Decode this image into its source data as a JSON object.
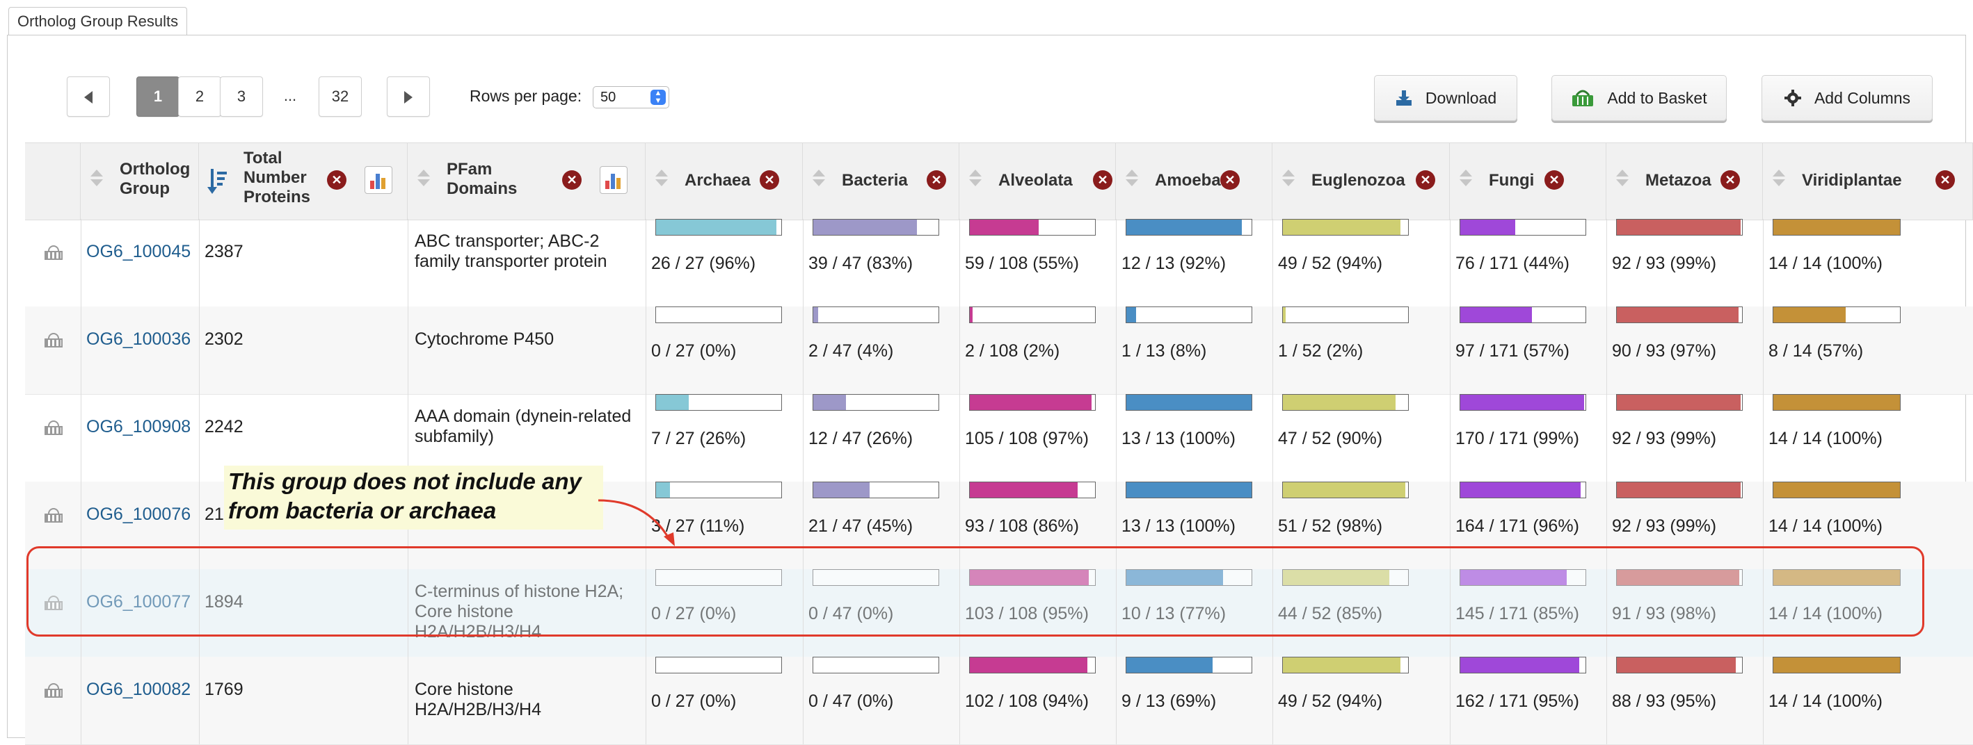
{
  "tab_label": "Ortholog Group Results",
  "pager": {
    "pages": [
      "1",
      "2",
      "3",
      "...",
      "32"
    ],
    "current": "1",
    "rows_per_page_label": "Rows per page:",
    "rows_per_page_value": "50"
  },
  "actions": {
    "download": "Download",
    "add_to_basket": "Add to Basket",
    "add_columns": "Add Columns"
  },
  "columns": {
    "group": "Ortholog Group",
    "total": "Total Number Proteins",
    "pfam": "PFam Domains",
    "taxa": [
      "Archaea",
      "Bacteria",
      "Alveolata",
      "Amoeba",
      "Euglenozoa",
      "Fungi",
      "Metazoa",
      "Viridiplantae"
    ]
  },
  "taxa_colors": [
    "#86c8d6",
    "#9d98c8",
    "#c63b92",
    "#4a8ec4",
    "#cfcf72",
    "#9f48d9",
    "#c96060",
    "#c49138"
  ],
  "rows": [
    {
      "group": "OG6_100045",
      "total": "2387",
      "pfam": "ABC transporter; ABC-2 family transporter protein",
      "counts": [
        "26 / 27 (96%)",
        "39 / 47 (83%)",
        "59 / 108 (55%)",
        "12 / 13 (92%)",
        "49 / 52 (94%)",
        "76 / 171 (44%)",
        "92 / 93 (99%)",
        "14 / 14 (100%)"
      ],
      "pct": [
        0.96,
        0.83,
        0.55,
        0.92,
        0.94,
        0.44,
        0.99,
        1.0
      ]
    },
    {
      "group": "OG6_100036",
      "total": "2302",
      "pfam": "Cytochrome P450",
      "counts": [
        "0 / 27 (0%)",
        "2 / 47 (4%)",
        "2 / 108 (2%)",
        "1 / 13 (8%)",
        "1 / 52 (2%)",
        "97 / 171 (57%)",
        "90 / 93 (97%)",
        "8 / 14 (57%)"
      ],
      "pct": [
        0.0,
        0.04,
        0.02,
        0.08,
        0.02,
        0.57,
        0.97,
        0.57
      ]
    },
    {
      "group": "OG6_100908",
      "total": "2242",
      "pfam": "AAA domain (dynein-related subfamily)",
      "counts": [
        "7 / 27 (26%)",
        "12 / 47 (26%)",
        "105 / 108 (97%)",
        "13 / 13 (100%)",
        "47 / 52 (90%)",
        "170 / 171 (99%)",
        "92 / 93 (99%)",
        "14 / 14 (100%)"
      ],
      "pct": [
        0.26,
        0.26,
        0.97,
        1.0,
        0.9,
        0.99,
        0.99,
        1.0
      ]
    },
    {
      "group": "OG6_100076",
      "total": "21",
      "pfam": "",
      "counts": [
        "3 / 27 (11%)",
        "21 / 47 (45%)",
        "93 / 108 (86%)",
        "13 / 13 (100%)",
        "51 / 52 (98%)",
        "164 / 171 (96%)",
        "92 / 93 (99%)",
        "14 / 14 (100%)"
      ],
      "pct": [
        0.11,
        0.45,
        0.86,
        1.0,
        0.98,
        0.96,
        0.99,
        1.0
      ]
    },
    {
      "group": "OG6_100077",
      "total": "1894",
      "pfam": "C-terminus of histone H2A; Core histone H2A/H2B/H3/H4",
      "counts": [
        "0 / 27 (0%)",
        "0 / 47 (0%)",
        "103 / 108 (95%)",
        "10 / 13 (77%)",
        "44 / 52 (85%)",
        "145 / 171 (85%)",
        "91 / 93 (98%)",
        "14 / 14 (100%)"
      ],
      "pct": [
        0.0,
        0.0,
        0.95,
        0.77,
        0.85,
        0.85,
        0.98,
        1.0
      ]
    },
    {
      "group": "OG6_100082",
      "total": "1769",
      "pfam": "Core histone H2A/H2B/H3/H4",
      "counts": [
        "0 / 27 (0%)",
        "0 / 47 (0%)",
        "102 / 108 (94%)",
        "9 / 13 (69%)",
        "49 / 52 (94%)",
        "162 / 171 (95%)",
        "88 / 93 (95%)",
        "14 / 14 (100%)"
      ],
      "pct": [
        0.0,
        0.0,
        0.94,
        0.69,
        0.94,
        0.95,
        0.95,
        1.0
      ]
    }
  ],
  "annotation": "This group does not include any from bacteria or archaea"
}
